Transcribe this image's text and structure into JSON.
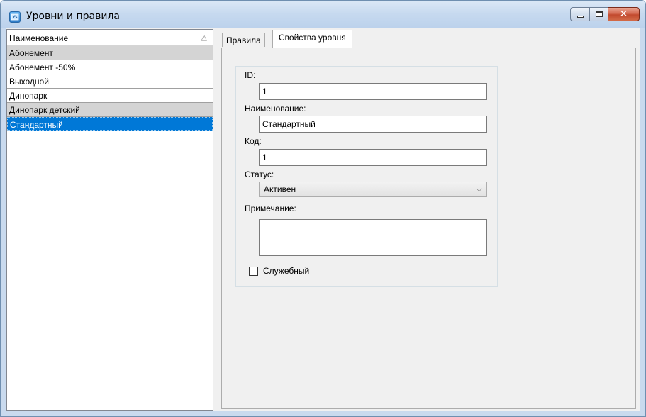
{
  "window": {
    "title": "Уровни и правила"
  },
  "list": {
    "header": "Наименование",
    "sort_glyph": "△",
    "rows": [
      "Абонемент",
      "Абонемент -50%",
      "Выходной",
      "Динопарк",
      "Динопарк детский",
      "Стандартный"
    ]
  },
  "tabs": [
    "Правила",
    "Свойства уровня"
  ],
  "form": {
    "id_label": "ID:",
    "id_value": "1",
    "name_label": "Наименование:",
    "name_value": "Стандартный",
    "code_label": "Код:",
    "code_value": "1",
    "status_label": "Статус:",
    "status_value": "Активен",
    "note_label": "Примечание:",
    "note_value": "",
    "service_label": "Служебный",
    "service_checked": false
  },
  "icons": {
    "app": "app-window-icon",
    "minimize": "minimize-icon",
    "maximize": "maximize-icon",
    "close": "close-icon",
    "dropdown": "chevron-down-icon",
    "sort": "sort-ascending-icon"
  },
  "colors": {
    "selection": "#0078d7",
    "group_row": "#d4d4d4",
    "close_button": "#c24a2e"
  }
}
